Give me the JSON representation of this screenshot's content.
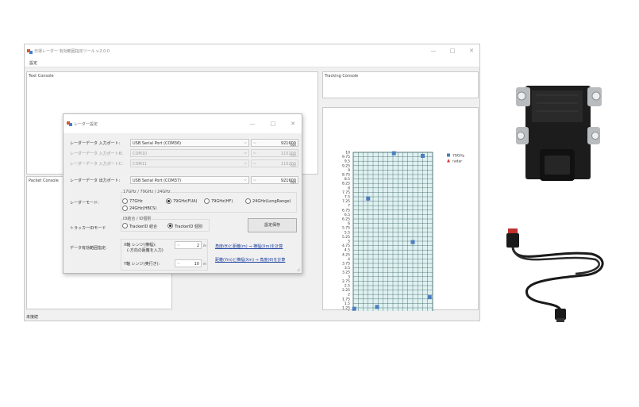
{
  "window": {
    "title": "日運レーダー 有効範囲指定ツール v.2.0.0",
    "minimize": "—",
    "maximize": "□",
    "close": "✕"
  },
  "menu": {
    "settings": "設定"
  },
  "panels": {
    "text_console": "Text Console",
    "packet_console": "Packet Console",
    "tracking_console": "Tracking Console"
  },
  "status": {
    "text": "未接続"
  },
  "dialog": {
    "title": "レーダー設定",
    "ports": [
      {
        "label": "レーダーデータ 入力ポート:",
        "port": "USB Serial Port (COM36)",
        "baud": "921600",
        "unit": "bps",
        "enabled": true
      },
      {
        "label": "レーダーデータ 入力ポートB:",
        "port": "COM10",
        "baud": "115200",
        "unit": "bps",
        "enabled": false
      },
      {
        "label": "レーダーデータ 入力ポートC:",
        "port": "COM11",
        "baud": "115200",
        "unit": "bps",
        "enabled": false
      },
      {
        "label": "レーダーデータ 出力ポート:",
        "port": "USB Serial Port (COM37)",
        "baud": "921600",
        "unit": "bps",
        "enabled": true
      }
    ],
    "radar_mode": {
      "label": "レーダーモード:",
      "group_title": "17GHz / 79GHz / 24GHz",
      "options": [
        "77GHz",
        "79GHz(FUA)",
        "79GHz(HF)",
        "24GHz(LongRange)",
        "24GHz(HBCS)"
      ],
      "selected": 1
    },
    "tracker_mode": {
      "label": "トラッカーIDモード",
      "group_title": "ID結合 / ID個別",
      "options": [
        "TrackerID 結合",
        "TrackerID 個別"
      ],
      "selected": 1
    },
    "save_button": "設定保存",
    "range": {
      "label": "データ有効範囲指定:",
      "x_label_1": "X軸 レンジ(横幅):",
      "x_label_2": "(-方向の距離を入力)",
      "x_value": "2",
      "y_label": "Y軸 レンジ(奥行き):",
      "y_value": "10",
      "unit": "m"
    },
    "links": {
      "angle_to_xy": "角度(θ)と距離(m) ⇒ 横幅(Xm)を計算",
      "xy_to_angle": "距離(Ym)と横幅(Xm) ⇒ 角度(θ)を計算"
    }
  },
  "chart_data": {
    "type": "scatter",
    "title": "",
    "xlabel": "",
    "ylabel": "",
    "xlim": [
      -2,
      2
    ],
    "ylim": [
      0,
      10
    ],
    "grid": true,
    "legend_position": "top-right",
    "x_ticks_major": [
      "-2",
      "-1",
      "0",
      "1",
      "2"
    ],
    "x_ticks_minor": [
      "-1.5",
      "-0.5",
      "0.5",
      "1.5"
    ],
    "y_ticks": [
      "0",
      "0.25",
      "0.5",
      "0.75",
      "1",
      "1.25",
      "1.5",
      "1.75",
      "2",
      "2.25",
      "2.5",
      "2.75",
      "3",
      "3.25",
      "3.5",
      "3.75",
      "4",
      "4.25",
      "4.5",
      "4.75",
      "5",
      "5.25",
      "5.5",
      "5.75",
      "6",
      "6.25",
      "6.5",
      "6.75",
      "7",
      "7.25",
      "7.5",
      "7.75",
      "8",
      "8.25",
      "8.5",
      "8.75",
      "9",
      "9.25",
      "9.5",
      "9.75",
      "10"
    ],
    "series": [
      {
        "name": "79GHz",
        "color": "#4a7fc1",
        "marker": "square",
        "points": [
          [
            -1.95,
            1.2
          ],
          [
            -1.25,
            7.4
          ],
          [
            -0.8,
            1.3
          ],
          [
            0.05,
            9.95
          ],
          [
            0.2,
            0.95
          ],
          [
            1.0,
            4.95
          ],
          [
            1.5,
            9.8
          ],
          [
            1.85,
            1.85
          ]
        ]
      },
      {
        "name": "radar",
        "color": "#d93a3a",
        "marker": "triangle",
        "points": [
          [
            0,
            0
          ]
        ]
      }
    ],
    "colors": {
      "grid": "#3a5f5f",
      "background": "#dff1f1"
    }
  }
}
